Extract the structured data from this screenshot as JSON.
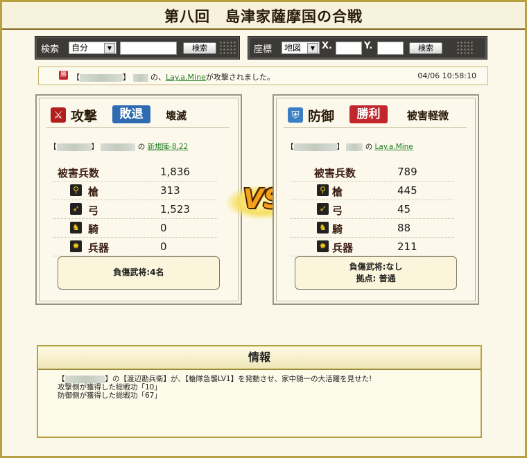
{
  "title": "第八回　島津家薩摩国の合戦",
  "search_bar": {
    "label": "検索",
    "select_value": "自分",
    "button": "検索"
  },
  "coord_bar": {
    "label": "座標",
    "select_value": "地図",
    "x_label": "X.",
    "y_label": "Y.",
    "button": "検索"
  },
  "notice": {
    "badge": "勝",
    "bracket_open": "【",
    "bracket_close": "】",
    "middle": "の、",
    "target_link": "Lay.a.Mine",
    "suffix": "が攻撃されました。",
    "time": "04/06 10:58:10"
  },
  "attack": {
    "side": "攻撃",
    "result": "敗退",
    "damage": "壊滅",
    "bracket_open": "【",
    "bracket_close": "】",
    "no": "の",
    "place_link": "新規陣-8,22",
    "stats": [
      {
        "label": "被害兵数",
        "value": "1,836",
        "icon": ""
      },
      {
        "label": "槍",
        "value": "313",
        "icon": "spear-icon"
      },
      {
        "label": "弓",
        "value": "1,523",
        "icon": "bow-icon"
      },
      {
        "label": "騎",
        "value": "0",
        "icon": "horse-icon"
      },
      {
        "label": "兵器",
        "value": "0",
        "icon": "siege-icon"
      }
    ],
    "summary_line1": "負傷武将:4名",
    "summary_line2": ""
  },
  "defense": {
    "side": "防御",
    "result": "勝利",
    "damage": "被害軽微",
    "bracket_open": "【",
    "bracket_close": "】",
    "no": "の",
    "place_link": "Lay.a.Mine",
    "stats": [
      {
        "label": "被害兵数",
        "value": "789",
        "icon": ""
      },
      {
        "label": "槍",
        "value": "445",
        "icon": "spear-icon"
      },
      {
        "label": "弓",
        "value": "45",
        "icon": "bow-icon"
      },
      {
        "label": "騎",
        "value": "88",
        "icon": "horse-icon"
      },
      {
        "label": "兵器",
        "value": "211",
        "icon": "siege-icon"
      }
    ],
    "summary_line1": "負傷武将:なし",
    "summary_line2": "拠点: 普通"
  },
  "vs_text": "VS",
  "info": {
    "title": "情報",
    "line1_open": "【",
    "line1_rest": "】の【渡辺勘兵衛】が、【槍隊急襲LV1】を発動させ、家中随一の大活躍を見せた!",
    "line2": "攻撃側が獲得した総戦功「10」",
    "line3": "防御側が獲得した総戦功「67」"
  },
  "colors": {
    "defeat_badge": "#2f6bb1",
    "victory_badge": "#c1272d",
    "link": "#1f7d1f",
    "frame": "#b8a141"
  }
}
